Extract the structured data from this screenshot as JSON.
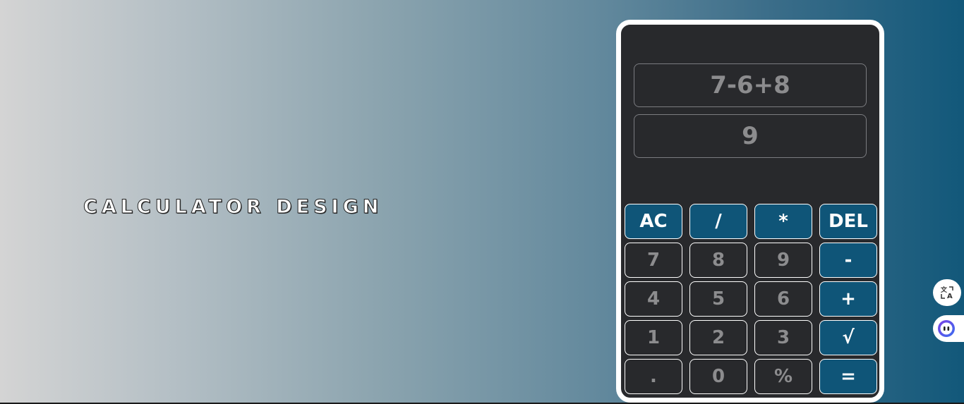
{
  "page": {
    "title": "CALCULATOR DESIGN"
  },
  "calculator": {
    "expression": "7-6+8",
    "result": "9",
    "keys": [
      {
        "label": "AC",
        "type": "operator"
      },
      {
        "label": "/",
        "type": "operator"
      },
      {
        "label": "*",
        "type": "operator"
      },
      {
        "label": "DEL",
        "type": "operator"
      },
      {
        "label": "7",
        "type": "digit"
      },
      {
        "label": "8",
        "type": "digit"
      },
      {
        "label": "9",
        "type": "digit"
      },
      {
        "label": "-",
        "type": "operator"
      },
      {
        "label": "4",
        "type": "digit"
      },
      {
        "label": "5",
        "type": "digit"
      },
      {
        "label": "6",
        "type": "digit"
      },
      {
        "label": "+",
        "type": "operator"
      },
      {
        "label": "1",
        "type": "digit"
      },
      {
        "label": "2",
        "type": "digit"
      },
      {
        "label": "3",
        "type": "digit"
      },
      {
        "label": "√",
        "type": "operator"
      },
      {
        "label": ".",
        "type": "digit"
      },
      {
        "label": "0",
        "type": "digit"
      },
      {
        "label": "%",
        "type": "digit"
      },
      {
        "label": "=",
        "type": "operator"
      }
    ]
  },
  "floating_buttons": {
    "translate_icon": "translate-icon",
    "assistant_icon": "assistant-icon"
  },
  "colors": {
    "operator_key": "#0f5578",
    "calculator_body": "#28292c",
    "gradient_start": "#d4d4d4",
    "gradient_end": "#12587a"
  }
}
